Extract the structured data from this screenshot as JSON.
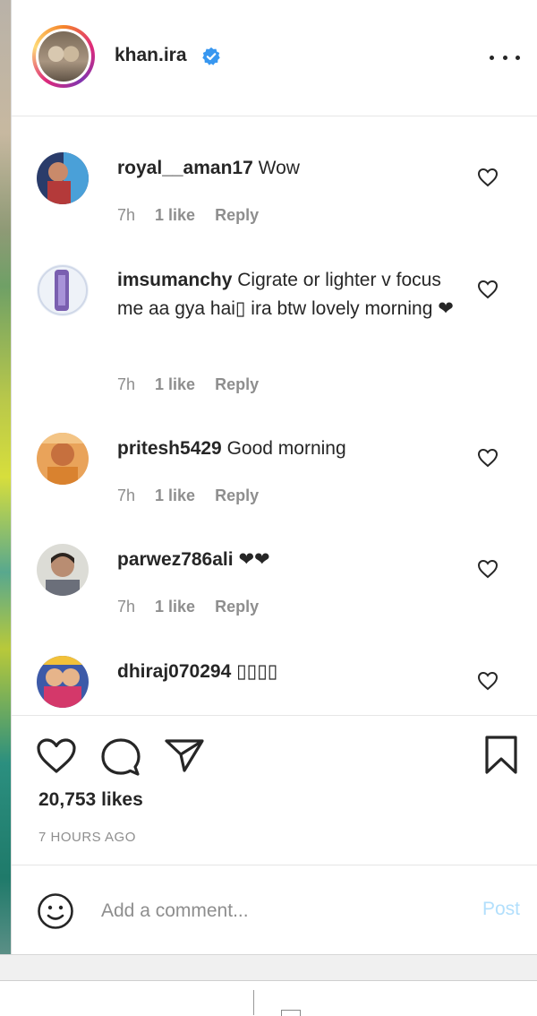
{
  "post": {
    "username": "khan.ira",
    "verified": true
  },
  "comments": [
    {
      "username": "royal__aman17",
      "text": "Wow",
      "time": "7h",
      "likes": "1 like",
      "reply": "Reply"
    },
    {
      "username": "imsumanchy",
      "text": "Cigrate or lighter v focus me aa gya hai▯ ira btw lovely morning ❤",
      "time": "7h",
      "likes": "1 like",
      "reply": "Reply"
    },
    {
      "username": "pritesh5429",
      "text": "Good morning",
      "time": "7h",
      "likes": "1 like",
      "reply": "Reply"
    },
    {
      "username": "parwez786ali",
      "text": "❤❤",
      "time": "7h",
      "likes": "1 like",
      "reply": "Reply"
    },
    {
      "username": "dhiraj070294",
      "text": "▯▯▯▯"
    }
  ],
  "actions": {
    "likes": "20,753 likes",
    "timestamp": "7 HOURS AGO"
  },
  "add_comment": {
    "placeholder": "Add a comment...",
    "post_label": "Post"
  },
  "colors": {
    "text": "#262626",
    "secondary": "#8e8e8e",
    "verified": "#3897f0",
    "post_disabled": "#b2dffc"
  }
}
